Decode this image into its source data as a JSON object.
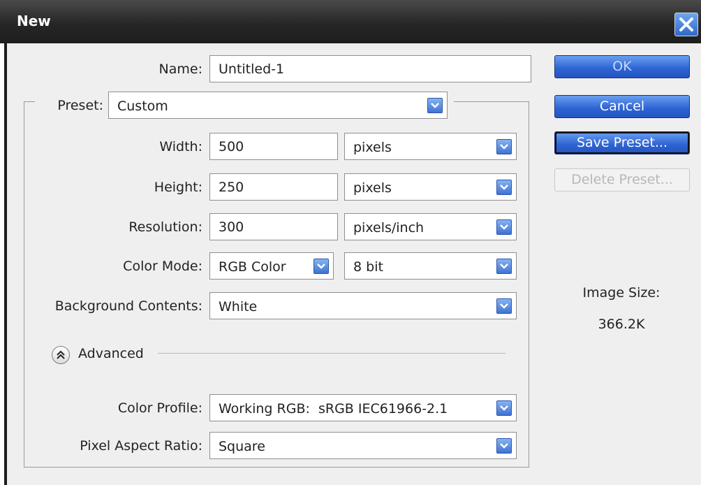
{
  "window": {
    "title": "New"
  },
  "form": {
    "name_label": "Name:",
    "name_value": "Untitled-1",
    "preset_label": "Preset:",
    "preset_value": "Custom",
    "width_label": "Width:",
    "width_value": "500",
    "width_unit": "pixels",
    "height_label": "Height:",
    "height_value": "250",
    "height_unit": "pixels",
    "resolution_label": "Resolution:",
    "resolution_value": "300",
    "resolution_unit": "pixels/inch",
    "color_mode_label": "Color Mode:",
    "color_mode_value": "RGB Color",
    "bit_depth_value": "8 bit",
    "background_label": "Background Contents:",
    "background_value": "White",
    "advanced_label": "Advanced",
    "color_profile_label": "Color Profile:",
    "color_profile_value": "Working RGB:  sRGB IEC61966-2.1",
    "pixel_aspect_label": "Pixel Aspect Ratio:",
    "pixel_aspect_value": "Square"
  },
  "buttons": {
    "ok": "OK",
    "cancel": "Cancel",
    "save_preset": "Save Preset...",
    "delete_preset": "Delete Preset..."
  },
  "info": {
    "image_size_label": "Image Size:",
    "image_size_value": "366.2K"
  },
  "icons": {
    "close": "close-icon",
    "dropdown": "chevron-down-icon",
    "advanced_toggle": "double-chevron-up-icon"
  },
  "colors": {
    "title_bar": "#262626",
    "button_blue": "#2c62d2",
    "dialog_bg": "#efefef"
  }
}
